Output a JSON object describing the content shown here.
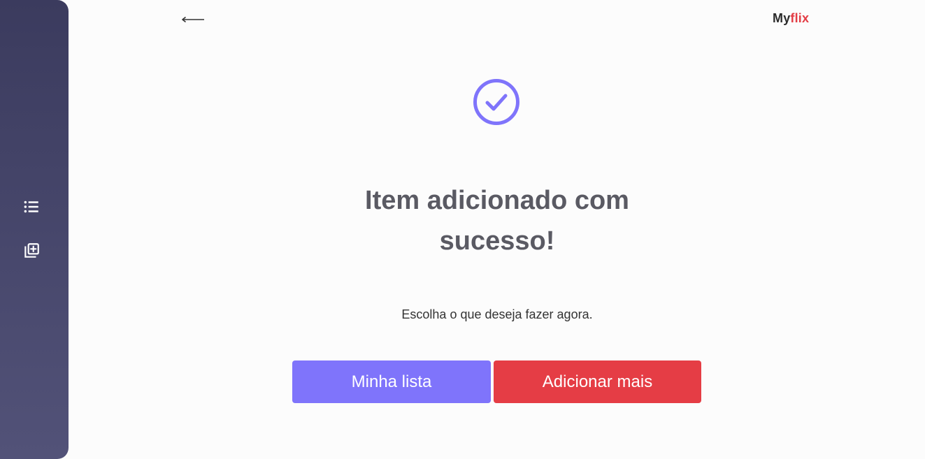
{
  "brand": {
    "name_part1": "My",
    "name_part2": "flix",
    "accent_color": "#e33d45"
  },
  "sidebar": {
    "items": [
      {
        "icon": "list-icon"
      },
      {
        "icon": "add-to-library-icon"
      }
    ]
  },
  "header": {
    "back_icon": "back-arrow-icon"
  },
  "main": {
    "status_icon": "check-circle-icon",
    "status_color": "#7f74fb",
    "title": "Item adicionado com sucesso!",
    "subtitle": "Escolha o que deseja fazer agora.",
    "actions": {
      "my_list_label": "Minha lista",
      "add_more_label": "Adicionar mais"
    }
  }
}
